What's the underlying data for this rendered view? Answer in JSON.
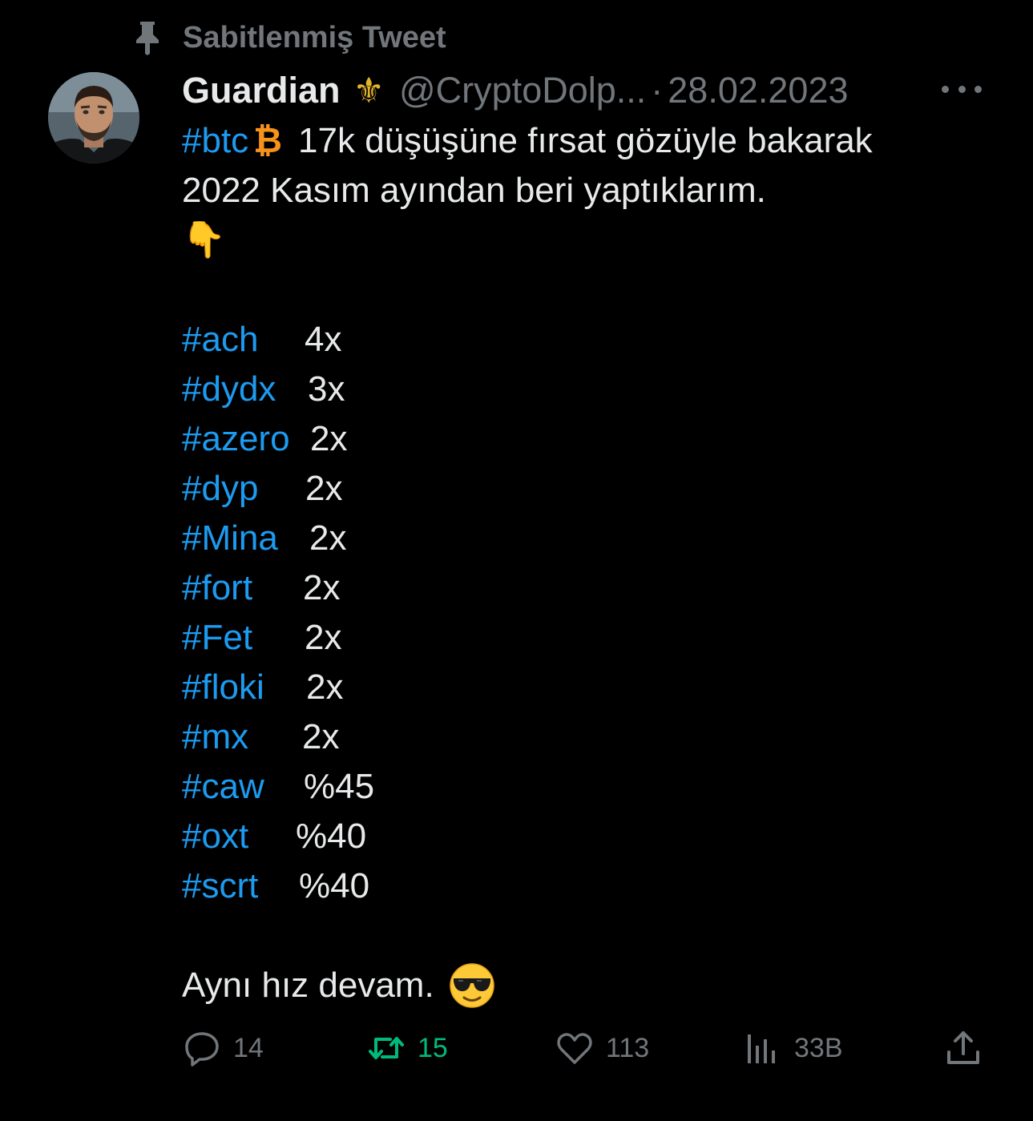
{
  "pinned": {
    "label": "Sabitlenmiş Tweet",
    "icon": "pin-icon"
  },
  "tweet": {
    "author": {
      "display_name": "Guardian",
      "badge_glyph": "⚜",
      "handle": "@CryptoDolp...",
      "separator": "·",
      "date": "28.02.2023"
    },
    "intro": {
      "hashtag": "#btc",
      "coin_glyph": "₿",
      "line1_text": "17k düşüşüne fırsat gözüyle bakarak",
      "line2_text": "2022 Kasım ayından beri yaptıklarım.",
      "pointing_emoji": "👇"
    },
    "coins": [
      {
        "tag": "#ach",
        "value": "4x"
      },
      {
        "tag": "#dydx",
        "value": "3x"
      },
      {
        "tag": "#azero",
        "value": "2x"
      },
      {
        "tag": "#dyp",
        "value": "2x"
      },
      {
        "tag": "#Mina",
        "value": "2x"
      },
      {
        "tag": "#fort",
        "value": "2x"
      },
      {
        "tag": "#Fet",
        "value": "2x"
      },
      {
        "tag": "#floki",
        "value": "2x"
      },
      {
        "tag": "#mx",
        "value": "2x"
      },
      {
        "tag": "#caw",
        "value": "%45"
      },
      {
        "tag": "#oxt",
        "value": "%40"
      },
      {
        "tag": "#scrt",
        "value": "%40"
      }
    ],
    "closing": {
      "text": "Aynı hız devam.",
      "emoji": "sunglasses-emoji"
    }
  },
  "actions": {
    "reply": {
      "count": "14",
      "icon": "reply-icon"
    },
    "retweet": {
      "count": "15",
      "icon": "retweet-icon"
    },
    "like": {
      "count": "113",
      "icon": "heart-icon"
    },
    "views": {
      "count": "33B",
      "icon": "views-icon"
    },
    "share": {
      "icon": "share-icon"
    }
  },
  "colors": {
    "background": "#000000",
    "text": "#e7e9ea",
    "muted": "#71767b",
    "link": "#1d9bf0",
    "retweet_active": "#00ba7c",
    "bitcoin": "#f7931a",
    "badge_gold": "#e3b32c"
  }
}
